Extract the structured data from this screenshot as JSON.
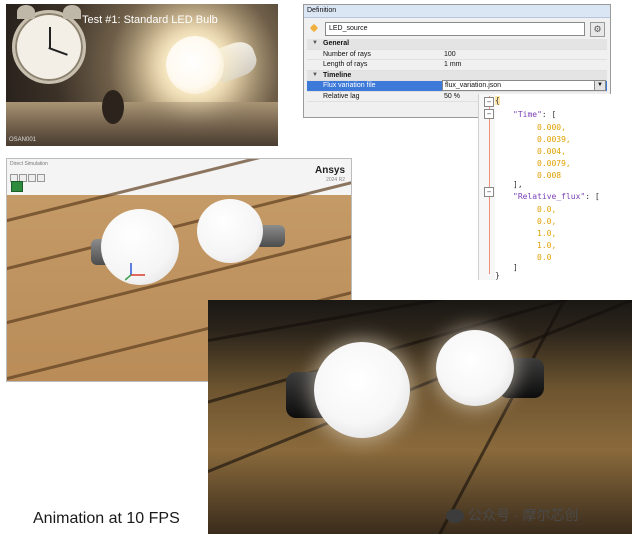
{
  "photo": {
    "title": "Test #1: Standard LED Bulb",
    "tag": "OSAN001"
  },
  "definition_panel": {
    "header": "Definition",
    "name_value": "LED_source",
    "settings_icon": "gear-icon",
    "edit_icon": "pencil-icon",
    "sections": [
      {
        "label": "General",
        "rows": [
          {
            "key": "Number of rays",
            "value": "100"
          },
          {
            "key": "Length of rays",
            "value": "1 mm"
          }
        ]
      },
      {
        "label": "Timeline",
        "rows": [
          {
            "key": "Flux variation file",
            "value": "flux_variation.json",
            "selected": true
          },
          {
            "key": "Relative lag",
            "value": "50 %"
          }
        ]
      }
    ]
  },
  "json_editor": {
    "open_brace": "{",
    "time_key": "\"Time\"",
    "time_values": [
      "0.000,",
      "0.0039,",
      "0.004,",
      "0.0079,",
      "0.008"
    ],
    "flux_key": "\"Relative_flux\"",
    "flux_values": [
      "0.0,",
      "0.0,",
      "1.0,",
      "1.0,",
      "0.0"
    ],
    "close_array_1": "],",
    "close_array_2": "]",
    "close_brace": "}"
  },
  "viewer": {
    "hud_text": "Direct Simulation",
    "brand": "Ansys",
    "version": "2024 R2"
  },
  "caption": "Animation at 10 FPS",
  "watermark": "公众号 · 摩尔芯创"
}
